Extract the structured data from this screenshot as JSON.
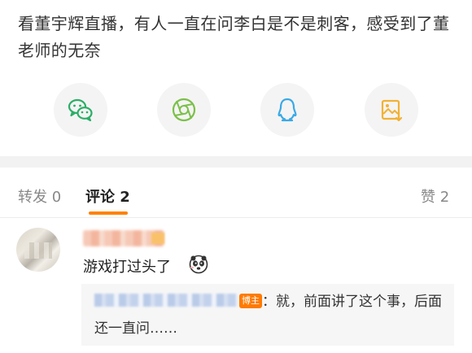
{
  "post": {
    "text": "看董宇辉直播，有人一直在问李白是不是刺客，感受到了董老师的无奈"
  },
  "share": {
    "items": [
      {
        "name": "wechat",
        "color": "#2aae67"
      },
      {
        "name": "moments",
        "color": "#7bc04a"
      },
      {
        "name": "qq",
        "color": "#39a9e6"
      },
      {
        "name": "save-image",
        "color": "#f2b134"
      }
    ]
  },
  "tabs": {
    "repost": "转发 0",
    "comments": "评论 2",
    "likes": "赞 2"
  },
  "comment": {
    "text": "游戏打过头了",
    "reply": {
      "tag": "博主",
      "text": "：就，前面讲了这个事，后面还一直问……"
    }
  },
  "colors": {
    "accent": "#ff8200"
  }
}
